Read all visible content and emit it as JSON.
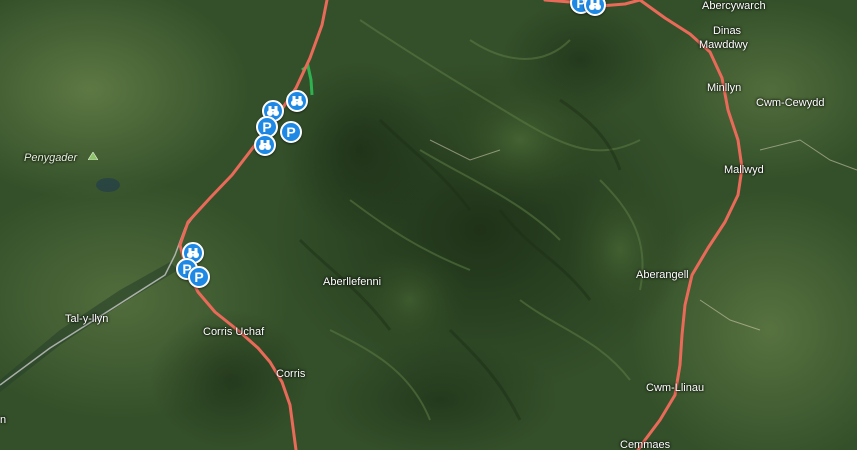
{
  "map": {
    "colors": {
      "road": "#ea6a5a",
      "track": "#c8c8c8",
      "green_track": "#2db24f",
      "pin": "#1e88e5"
    },
    "places": {
      "abercywarch": "Abercywarch",
      "dinas_mawddwy_1": "Dinas",
      "dinas_mawddwy_2": "Mawddwy",
      "minllyn": "Minllyn",
      "cwm_cewydd": "Cwm-Cewydd",
      "mallwyd": "Mallwyd",
      "penygader": "Penygader",
      "aberllefenni": "Aberllefenni",
      "aberangell": "Aberangell",
      "tal_y_llyn": "Tal-y-llyn",
      "corris_uchaf": "Corris Uchaf",
      "corris": "Corris",
      "cwm_llinau": "Cwm-Llinau",
      "cemmaes": "Cemmaes",
      "partial_left": "n"
    },
    "markers": [
      {
        "id": "viewpoint-1",
        "icon": "binoculars-icon"
      },
      {
        "id": "parking-1",
        "icon": "parking-icon",
        "text": "P"
      },
      {
        "id": "viewpoint-2",
        "icon": "binoculars-icon"
      },
      {
        "id": "parking-2",
        "icon": "parking-icon",
        "text": "P"
      },
      {
        "id": "viewpoint-3",
        "icon": "binoculars-icon"
      },
      {
        "id": "viewpoint-4",
        "icon": "binoculars-icon"
      },
      {
        "id": "parking-3",
        "icon": "parking-icon",
        "text": "P"
      },
      {
        "id": "parking-4",
        "icon": "parking-icon",
        "text": "P"
      }
    ]
  }
}
